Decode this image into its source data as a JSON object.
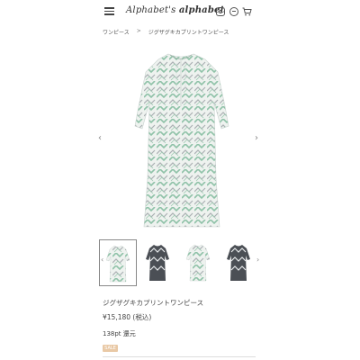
{
  "header": {
    "logo_script": "Alphabet's",
    "logo_bold": "alphabet",
    "icons": [
      "menu-icon",
      "instagram-icon",
      "line-icon",
      "cart-icon"
    ]
  },
  "breadcrumb": {
    "items": [
      "ワンピース",
      "ジグザグキカプリントワンピース"
    ],
    "separator": ">"
  },
  "gallery": {
    "prev": "‹",
    "next": "›",
    "thumb_prev": "‹",
    "thumb_next": "›"
  },
  "product": {
    "name": "ジグザグキカプリントワンピース",
    "price": "¥15,180 (税込)",
    "points": "138pt 還元",
    "badge": "SALE"
  },
  "colors": {
    "badge": "#e9c9a6",
    "print_green": "#8fc2a8",
    "print_grey": "#aab0b3"
  }
}
